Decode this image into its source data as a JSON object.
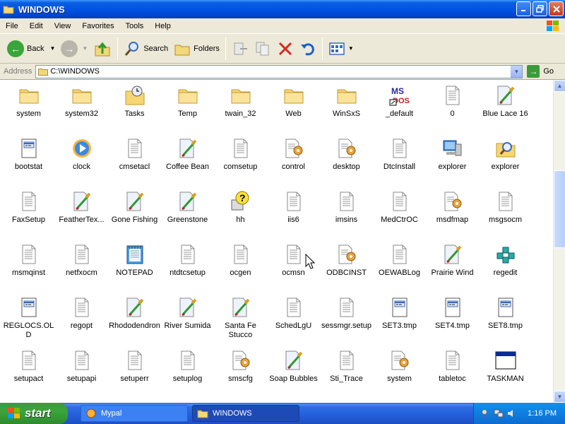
{
  "window": {
    "title": "WINDOWS"
  },
  "menu": [
    "File",
    "Edit",
    "View",
    "Favorites",
    "Tools",
    "Help"
  ],
  "toolbar": {
    "back": "Back",
    "search": "Search",
    "folders": "Folders"
  },
  "address": {
    "label": "Address",
    "value": "C:\\WINDOWS",
    "go": "Go"
  },
  "items": [
    {
      "label": "system",
      "icon": "folder-icon"
    },
    {
      "label": "system32",
      "icon": "folder-icon"
    },
    {
      "label": "Tasks",
      "icon": "tasks-folder-icon"
    },
    {
      "label": "Temp",
      "icon": "folder-icon"
    },
    {
      "label": "twain_32",
      "icon": "folder-icon"
    },
    {
      "label": "Web",
      "icon": "folder-icon"
    },
    {
      "label": "WinSxS",
      "icon": "folder-icon"
    },
    {
      "label": "_default",
      "icon": "msdos-shortcut-icon"
    },
    {
      "label": "0",
      "icon": "text-file-icon"
    },
    {
      "label": "Blue Lace 16",
      "icon": "bitmap-icon"
    },
    {
      "label": "bootstat",
      "icon": "dat-file-icon"
    },
    {
      "label": "clock",
      "icon": "media-icon"
    },
    {
      "label": "cmsetacl",
      "icon": "text-file-icon"
    },
    {
      "label": "Coffee Bean",
      "icon": "bitmap-icon"
    },
    {
      "label": "comsetup",
      "icon": "text-file-icon"
    },
    {
      "label": "control",
      "icon": "settings-file-icon"
    },
    {
      "label": "desktop",
      "icon": "settings-file-icon"
    },
    {
      "label": "DtcInstall",
      "icon": "text-file-icon"
    },
    {
      "label": "explorer",
      "icon": "explorer-icon"
    },
    {
      "label": "explorer",
      "icon": "explorer-search-icon"
    },
    {
      "label": "FaxSetup",
      "icon": "text-file-icon"
    },
    {
      "label": "FeatherTex...",
      "icon": "bitmap-icon"
    },
    {
      "label": "Gone Fishing",
      "icon": "bitmap-icon"
    },
    {
      "label": "Greenstone",
      "icon": "bitmap-icon"
    },
    {
      "label": "hh",
      "icon": "help-icon"
    },
    {
      "label": "iis6",
      "icon": "text-file-icon"
    },
    {
      "label": "imsins",
      "icon": "text-file-icon"
    },
    {
      "label": "MedCtrOC",
      "icon": "text-file-icon"
    },
    {
      "label": "msdfmap",
      "icon": "settings-file-icon"
    },
    {
      "label": "msgsocm",
      "icon": "text-file-icon"
    },
    {
      "label": "msmqinst",
      "icon": "text-file-icon"
    },
    {
      "label": "netfxocm",
      "icon": "text-file-icon"
    },
    {
      "label": "NOTEPAD",
      "icon": "notepad-icon"
    },
    {
      "label": "ntdtcsetup",
      "icon": "text-file-icon"
    },
    {
      "label": "ocgen",
      "icon": "text-file-icon"
    },
    {
      "label": "ocmsn",
      "icon": "text-file-icon"
    },
    {
      "label": "ODBCINST",
      "icon": "settings-file-icon"
    },
    {
      "label": "OEWABLog",
      "icon": "text-file-icon"
    },
    {
      "label": "Prairie Wind",
      "icon": "bitmap-icon"
    },
    {
      "label": "regedit",
      "icon": "regedit-icon"
    },
    {
      "label": "REGLOCS.OLD",
      "icon": "dat-file-icon"
    },
    {
      "label": "regopt",
      "icon": "text-file-icon"
    },
    {
      "label": "Rhododendron",
      "icon": "bitmap-icon"
    },
    {
      "label": "River Sumida",
      "icon": "bitmap-icon"
    },
    {
      "label": "Santa Fe Stucco",
      "icon": "bitmap-icon"
    },
    {
      "label": "SchedLgU",
      "icon": "text-file-icon"
    },
    {
      "label": "sessmgr.setup",
      "icon": "text-file-icon"
    },
    {
      "label": "SET3.tmp",
      "icon": "dat-file-icon"
    },
    {
      "label": "SET4.tmp",
      "icon": "dat-file-icon"
    },
    {
      "label": "SET8.tmp",
      "icon": "dat-file-icon"
    },
    {
      "label": "setupact",
      "icon": "text-file-icon"
    },
    {
      "label": "setupapi",
      "icon": "text-file-icon"
    },
    {
      "label": "setuperr",
      "icon": "text-file-icon"
    },
    {
      "label": "setuplog",
      "icon": "text-file-icon"
    },
    {
      "label": "smscfg",
      "icon": "settings-file-icon"
    },
    {
      "label": "Soap Bubbles",
      "icon": "bitmap-icon"
    },
    {
      "label": "Sti_Trace",
      "icon": "text-file-icon"
    },
    {
      "label": "system",
      "icon": "settings-file-icon"
    },
    {
      "label": "tabletoc",
      "icon": "text-file-icon"
    },
    {
      "label": "TASKMAN",
      "icon": "application-window-icon"
    }
  ],
  "taskbar": {
    "start": "start",
    "tasks": [
      {
        "label": "Mypal",
        "active": false
      },
      {
        "label": "WINDOWS",
        "active": true
      }
    ],
    "clock": "1:16 PM"
  },
  "colors": {
    "title_bar": "#0054e3",
    "start_button": "#3aa53a",
    "taskbar": "#245edb",
    "tray": "#0f7ee0"
  }
}
